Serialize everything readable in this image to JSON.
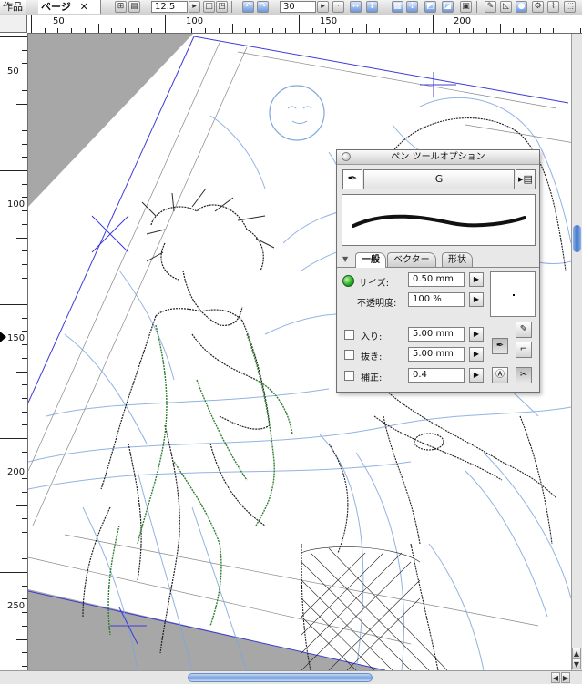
{
  "toolbar": {
    "tabs": [
      {
        "label": "作品"
      },
      {
        "label": "ページ"
      }
    ],
    "close_glyph": "✕",
    "zoom_value": "12.5",
    "angle_value": "30",
    "icons": [
      "page-layout-icon",
      "page-view-icon",
      "rotate-left-icon",
      "rotate-right-icon",
      "flip-horizontal-icon",
      "flip-vertical-icon",
      "grid-icon",
      "ruler-icon",
      "layer-icon",
      "pen-icon",
      "triangle-ruler-icon",
      "fill-icon",
      "gear-icon"
    ]
  },
  "rulers": {
    "top_labels": [
      "50",
      "100",
      "150",
      "200"
    ],
    "left_labels": [
      "50",
      "100",
      "150",
      "200",
      "250"
    ]
  },
  "palette": {
    "title": "ペン ツールオプション",
    "brush_name": "G",
    "tabs": [
      {
        "label": "一般"
      },
      {
        "label": "ベクター"
      },
      {
        "label": "形状"
      }
    ],
    "rows": [
      {
        "label": "サイズ:",
        "value": "0.50 mm"
      },
      {
        "label": "不透明度:",
        "value": "100 %"
      },
      {
        "label": "入り:",
        "value": "5.00 mm"
      },
      {
        "label": "抜き:",
        "value": "5.00 mm"
      },
      {
        "label": "補正:",
        "value": "0.4"
      }
    ],
    "arrow_glyph": "▶"
  },
  "colors": {
    "sketch_blue": "#7fa6dc",
    "ink_green": "#2f7d2f",
    "page_border_blue": "#3c3cd6",
    "canvas_gray": "#a7a7a7",
    "scroll_blue": "#3f74c9"
  }
}
